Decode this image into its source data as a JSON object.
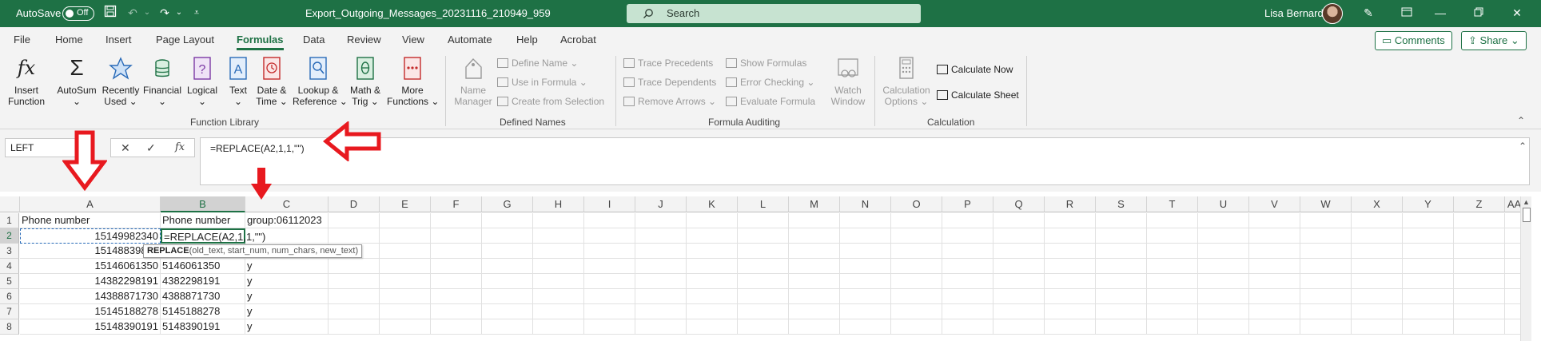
{
  "titlebar": {
    "autosave_label": "AutoSave",
    "autosave_state": "Off",
    "filename": "Export_Outgoing_Messages_20231116_210949_959",
    "search_placeholder": "Search",
    "user_name": "Lisa Bernard"
  },
  "tabs": [
    "File",
    "Home",
    "Insert",
    "Page Layout",
    "Formulas",
    "Data",
    "Review",
    "View",
    "Automate",
    "Help",
    "Acrobat"
  ],
  "active_tab": "Formulas",
  "comments_label": "Comments",
  "share_label": "Share",
  "ribbon": {
    "function_library": {
      "label": "Function Library",
      "buttons": [
        {
          "l1": "Insert",
          "l2": "Function"
        },
        {
          "l1": "AutoSum",
          "l2": "⌄"
        },
        {
          "l1": "Recently",
          "l2": "Used ⌄"
        },
        {
          "l1": "Financial",
          "l2": "⌄"
        },
        {
          "l1": "Logical",
          "l2": "⌄"
        },
        {
          "l1": "Text",
          "l2": "⌄"
        },
        {
          "l1": "Date &",
          "l2": "Time ⌄"
        },
        {
          "l1": "Lookup &",
          "l2": "Reference ⌄"
        },
        {
          "l1": "Math &",
          "l2": "Trig ⌄"
        },
        {
          "l1": "More",
          "l2": "Functions ⌄"
        }
      ]
    },
    "defined_names": {
      "label": "Defined Names",
      "name_manager": {
        "l1": "Name",
        "l2": "Manager"
      },
      "items": [
        "Define Name ⌄",
        "Use in Formula ⌄",
        "Create from Selection"
      ]
    },
    "formula_auditing": {
      "label": "Formula Auditing",
      "left": [
        "Trace Precedents",
        "Trace Dependents",
        "Remove Arrows ⌄"
      ],
      "right": [
        "Show Formulas",
        "Error Checking ⌄",
        "Evaluate Formula"
      ],
      "watch": {
        "l1": "Watch",
        "l2": "Window"
      }
    },
    "calculation": {
      "label": "Calculation",
      "options": {
        "l1": "Calculation",
        "l2": "Options ⌄"
      },
      "items": [
        "Calculate Now",
        "Calculate Sheet"
      ]
    }
  },
  "formula_bar": {
    "name_box": "LEFT",
    "formula": "=REPLACE(A2,1,1,\"\")"
  },
  "grid": {
    "columns": [
      "A",
      "B",
      "C",
      "D",
      "E",
      "F",
      "G",
      "H",
      "I",
      "J",
      "K",
      "L",
      "M",
      "N",
      "O",
      "P",
      "Q",
      "R",
      "S",
      "T",
      "U",
      "V",
      "W",
      "X",
      "Y",
      "Z",
      "AA"
    ],
    "rows": [
      {
        "n": "1",
        "a": "Phone number",
        "b": "Phone number",
        "c": "group:06112023"
      },
      {
        "n": "2",
        "a": "15149982340",
        "b": "=REPLACE(A2,1,1,\"\")",
        "c": ""
      },
      {
        "n": "3",
        "a": "15148839869",
        "b": "5",
        "c": ""
      },
      {
        "n": "4",
        "a": "15146061350",
        "b": "5146061350",
        "c": "y"
      },
      {
        "n": "5",
        "a": "14382298191",
        "b": "4382298191",
        "c": "y"
      },
      {
        "n": "6",
        "a": "14388871730",
        "b": "4388871730",
        "c": "y"
      },
      {
        "n": "7",
        "a": "15145188278",
        "b": "5145188278",
        "c": "y"
      },
      {
        "n": "8",
        "a": "15148390191",
        "b": "5148390191",
        "c": "y"
      }
    ],
    "tooltip_fn": "REPLACE",
    "tooltip_args": "(old_text, start_num, num_chars, new_text)"
  },
  "colors": {
    "accent": "#1e7145",
    "arrow": "#e8191f"
  }
}
